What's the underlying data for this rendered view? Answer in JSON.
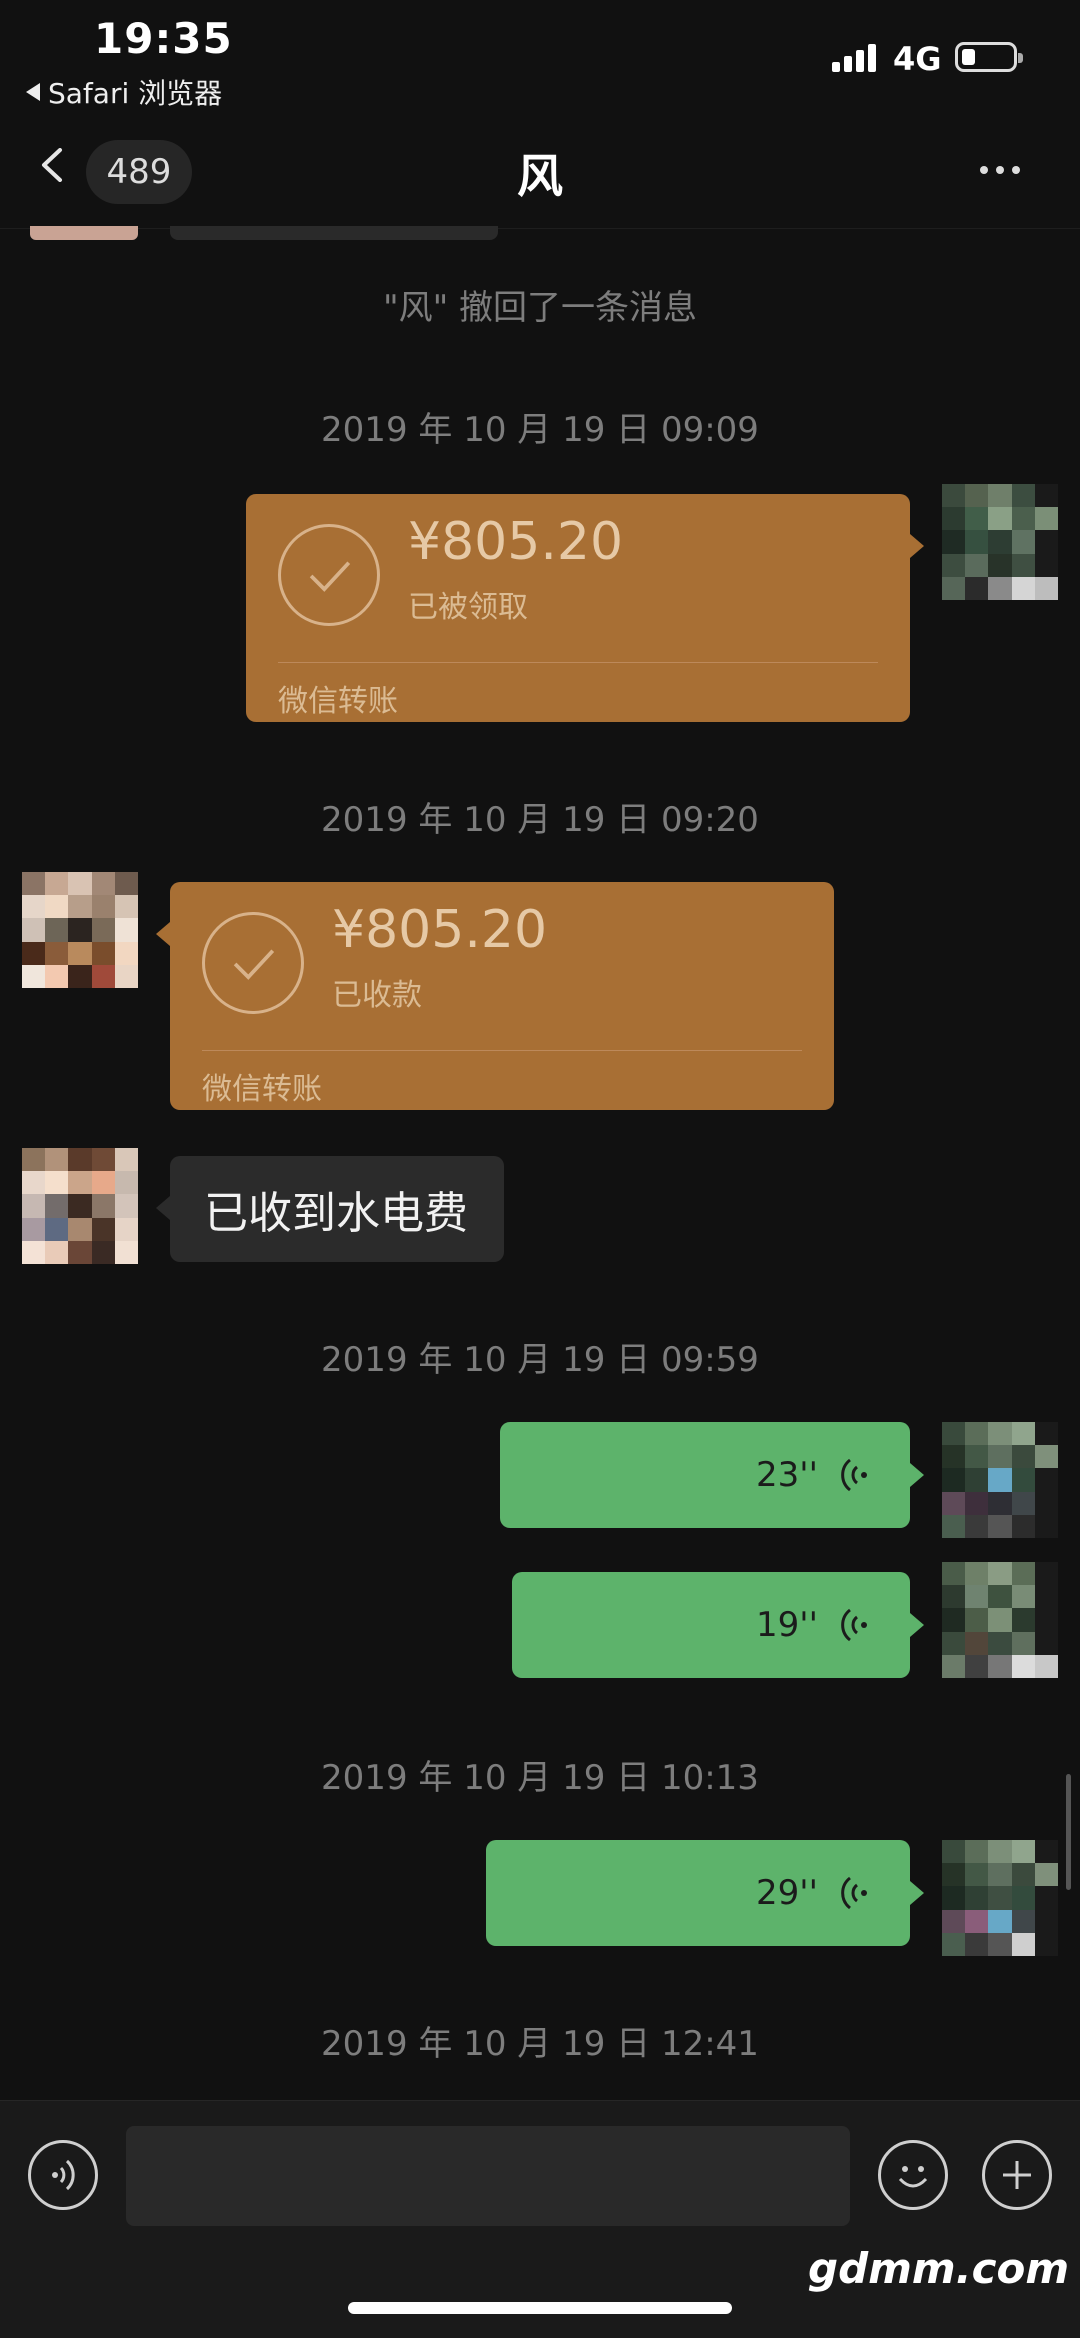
{
  "status_bar": {
    "time": "19:35",
    "back_app": "Safari 浏览器",
    "network": "4G",
    "battery_level": 0.25
  },
  "nav": {
    "unread_count": "489",
    "title": "风"
  },
  "messages": {
    "recall_notice": "\"风\" 撤回了一条消息",
    "ts1": "2019 年 10 月 19 日 09:09",
    "transfer_sent": {
      "amount": "¥805.20",
      "status": "已被领取",
      "footer": "微信转账"
    },
    "ts2": "2019 年 10 月 19 日 09:20",
    "transfer_received": {
      "amount": "¥805.20",
      "status": "已收款",
      "footer": "微信转账"
    },
    "text_received": "已收到水电费",
    "ts3": "2019 年 10 月 19 日 09:59",
    "voice1": "23''",
    "voice2": "19''",
    "ts4": "2019 年 10 月 19 日 10:13",
    "voice3": "29''",
    "ts5": "2019 年 10 月 19 日 12:41"
  },
  "watermark": "gdmm.com",
  "colors": {
    "transfer": "#a86f34",
    "voice_bubble": "#5db36b",
    "text_bubble": "#2b2b2b"
  }
}
